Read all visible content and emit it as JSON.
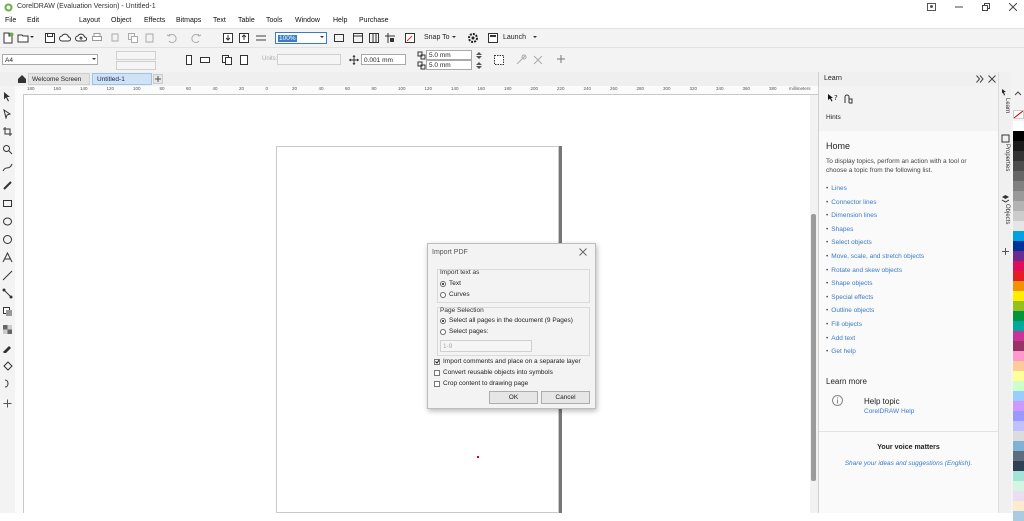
{
  "window": {
    "title": "CorelDRAW (Evaluation Version) - Untitled-1"
  },
  "menu": [
    "File",
    "Edit",
    "Layout",
    "Object",
    "Effects",
    "Bitmaps",
    "Text",
    "Table",
    "Tools",
    "Window",
    "Help",
    "Purchase"
  ],
  "toolbar": {
    "zoom": "100%",
    "snap_label": "Snap To",
    "launch_label": "Launch"
  },
  "property_bar": {
    "page_size": "A4",
    "units": "Units:",
    "nudge": "0.001 mm",
    "dup_x": "5.0 mm",
    "dup_y": "5.0 mm"
  },
  "tabs": [
    {
      "label": "Welcome Screen"
    },
    {
      "label": "Untitled-1"
    }
  ],
  "ruler": {
    "unit": "millimeters",
    "ticks": [
      "180",
      "160",
      "140",
      "120",
      "100",
      "80",
      "60",
      "40",
      "20",
      "0",
      "20",
      "40",
      "60",
      "80",
      "100",
      "120",
      "140",
      "160",
      "180",
      "200",
      "220",
      "240",
      "260",
      "280",
      "300",
      "320",
      "340",
      "360",
      "380"
    ]
  },
  "dialog": {
    "title": "Import PDF",
    "group1_caption": "Import text as",
    "opt_text": "Text",
    "opt_curves": "Curves",
    "group2_caption": "Page Selection",
    "opt_all": "Select all pages in the document (9 Pages)",
    "opt_select": "Select pages:",
    "pages_value": "1-9",
    "chk_comments": "Import comments and place on a separate layer",
    "chk_symbols": "Convert reusable objects into symbols",
    "chk_crop": "Crop content to drawing page",
    "ok": "OK",
    "cancel": "Cancel"
  },
  "learn": {
    "header": "Learn",
    "hints": "Hints",
    "home_title": "Home",
    "intro": "To display topics, perform an action with a tool or choose a topic from the following list.",
    "links": [
      "Lines",
      "Connector lines",
      "Dimension lines",
      "Shapes",
      "Select objects",
      "Move, scale, and stretch objects",
      "Rotate and skew objects",
      "Shape objects",
      "Special effects",
      "Outline objects",
      "Fill objects",
      "Add text",
      "Get help"
    ],
    "learn_more": "Learn more",
    "help_topic": "Help topic",
    "help_link": "CorelDRAW Help",
    "voice": "Your voice matters",
    "share": "Share your ideas and suggestions (English)."
  },
  "side_tabs": [
    "Learn",
    "Properties",
    "Objects"
  ],
  "palette": [
    "#ffffff",
    "#000000",
    "#1a1a1a",
    "#333333",
    "#4d4d4d",
    "#666666",
    "#808080",
    "#999999",
    "#b3b3b3",
    "#cccccc",
    "#e6e6e6",
    "#00a0e3",
    "#003399",
    "#6a2c91",
    "#e30b5c",
    "#e31e24",
    "#f39200",
    "#ffed00",
    "#95c11f",
    "#009640",
    "#00a99d",
    "#cc3399",
    "#993366",
    "#ff99cc",
    "#ffcc99",
    "#ffff99",
    "#ccffcc",
    "#99ccff",
    "#cc99ff",
    "#9999ff",
    "#c0c0ff",
    "#dcdcdc",
    "#7fb3d5",
    "#5d6d7e",
    "#2e4053",
    "#a3e4d7",
    "#d5f5e3",
    "#ebdef0",
    "#fdebd0",
    "#a9cce3"
  ]
}
